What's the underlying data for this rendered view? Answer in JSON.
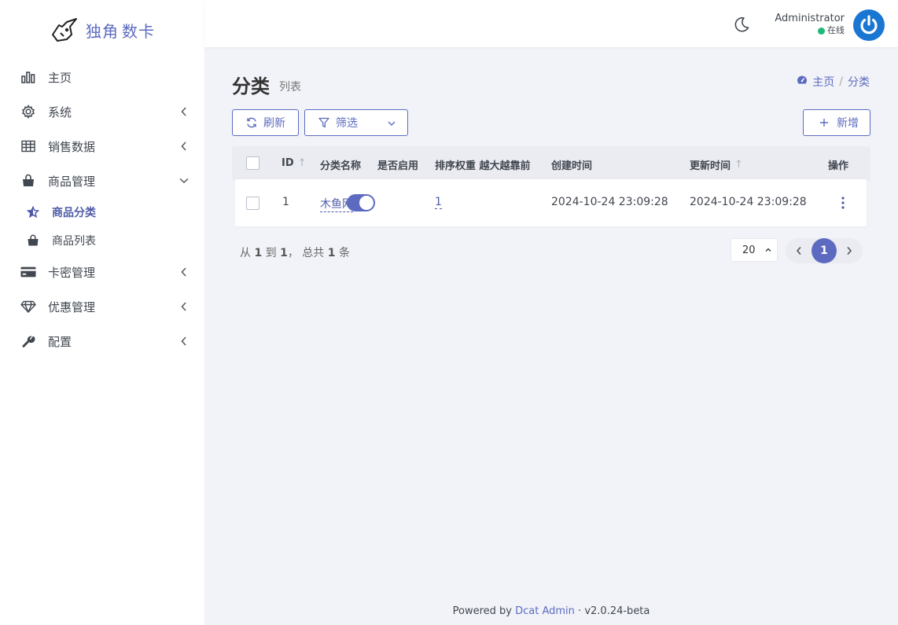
{
  "brand": {
    "part1": "独角",
    "part2": "数卡"
  },
  "sidebar": {
    "items": [
      {
        "label": "主页",
        "icon": "bar-chart-icon"
      },
      {
        "label": "系统",
        "icon": "gear-icon"
      },
      {
        "label": "销售数据",
        "icon": "table-icon"
      },
      {
        "label": "商品管理",
        "icon": "shopping-bag-icon"
      },
      {
        "label": "卡密管理",
        "icon": "credit-card-icon"
      },
      {
        "label": "优惠管理",
        "icon": "diamond-icon"
      },
      {
        "label": "配置",
        "icon": "wrench-icon"
      }
    ],
    "sub_items": [
      {
        "label": "商品分类",
        "icon": "star-icon",
        "active": true
      },
      {
        "label": "商品列表",
        "icon": "shopping-bag-icon",
        "active": false
      }
    ]
  },
  "navbar": {
    "user_name": "Administrator",
    "user_status": "在线",
    "status_color": "#21b978"
  },
  "page": {
    "title": "分类",
    "subtitle": "列表",
    "breadcrumb": {
      "home": "主页",
      "current": "分类"
    }
  },
  "toolbar": {
    "refresh": "刷新",
    "filter": "筛选",
    "new": "新增"
  },
  "table": {
    "headers": {
      "id": "ID",
      "name": "分类名称",
      "enabled": "是否启用",
      "sort": "排序权重 越大越靠前",
      "created": "创建时间",
      "updated": "更新时间",
      "actions": "操作"
    },
    "rows": [
      {
        "id": "1",
        "name": "木鱼网",
        "enabled": true,
        "sort": "1",
        "created": "2024-10-24 23:09:28",
        "updated": "2024-10-24 23:09:28"
      }
    ]
  },
  "pagination": {
    "summary_prefix": "从",
    "from": "1",
    "to_word": "到",
    "to": "1",
    "total_word": "， 总共",
    "total": "1",
    "unit": "条",
    "per_page": "20",
    "current_page": "1"
  },
  "footer": {
    "prefix": "Powered by",
    "link": "Dcat Admin",
    "sep": "·",
    "version": "v2.0.24-beta"
  },
  "colors": {
    "accent": "#5c6bc0",
    "avatar": "#1976d2"
  }
}
